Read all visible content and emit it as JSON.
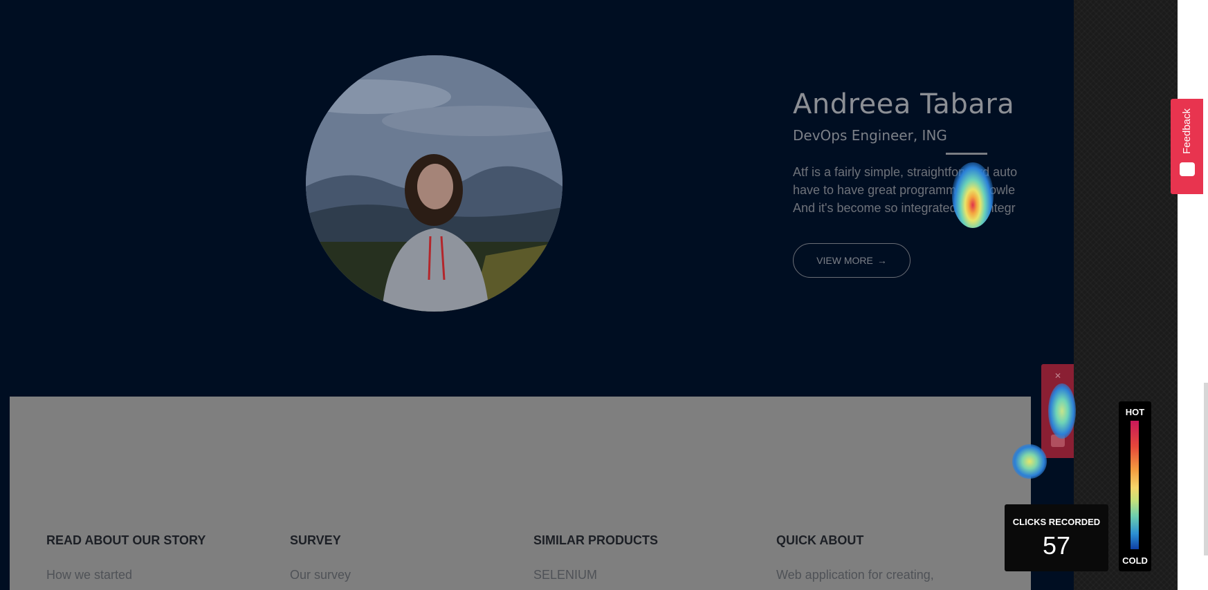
{
  "profile": {
    "name": "Andreea Tabara",
    "role": "DevOps Engineer, ING",
    "description": [
      "Atf is a fairly simple, straightforward auto",
      "have to have great programming knowle",
      "And it's become so integrated and integr"
    ],
    "button_label": "VIEW MORE"
  },
  "footer": {
    "columns": [
      {
        "heading": "READ ABOUT OUR STORY",
        "item": "How we started"
      },
      {
        "heading": "SURVEY",
        "item": "Our survey"
      },
      {
        "heading": "SIMILAR PRODUCTS",
        "item": "SELENIUM"
      },
      {
        "heading": "QUICK ABOUT",
        "item": "Web application for creating,"
      }
    ]
  },
  "feedback": {
    "label": "Feedback"
  },
  "heatmap": {
    "hot_label": "HOT",
    "cold_label": "COLD",
    "clicks_label": "CLICKS RECORDED",
    "clicks_count": "57"
  },
  "colors": {
    "feedback_red": "#e8344f",
    "page_bg": "#000e22"
  }
}
